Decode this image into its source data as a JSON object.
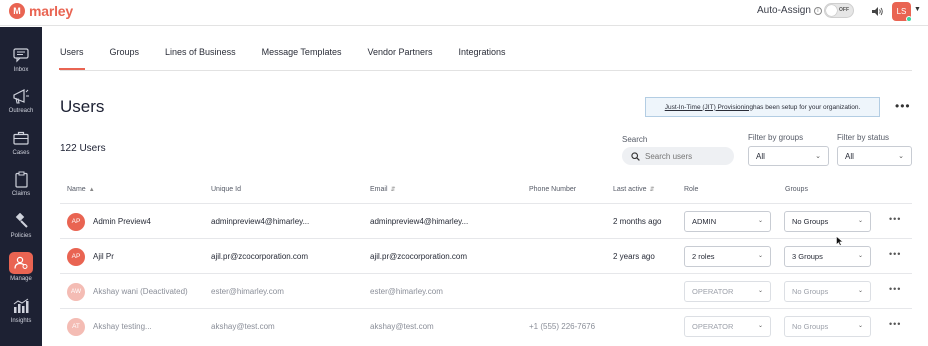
{
  "brand": {
    "name": "marley",
    "mark": "M",
    "color": "#e96452"
  },
  "topbar": {
    "auto_assign_label": "Auto-Assign",
    "info_icon": "info-icon",
    "toggle_state": "OFF",
    "speaker_icon": "speaker-icon",
    "user_initials": "LS"
  },
  "sidebar": {
    "items": [
      {
        "label": "Inbox",
        "icon": "chat-icon"
      },
      {
        "label": "Outreach",
        "icon": "megaphone-icon"
      },
      {
        "label": "Cases",
        "icon": "briefcase-icon"
      },
      {
        "label": "Claims",
        "icon": "clipboard-icon"
      },
      {
        "label": "Policies",
        "icon": "gavel-icon"
      },
      {
        "label": "Manage",
        "icon": "manage-users-icon",
        "active": true
      },
      {
        "label": "Insights",
        "icon": "bar-chart-icon"
      }
    ]
  },
  "tabs": [
    "Users",
    "Groups",
    "Lines of Business",
    "Message Templates",
    "Vendor Partners",
    "Integrations"
  ],
  "page": {
    "title": "Users",
    "banner_link": "Just-In-Time (JIT) Provisioning",
    "banner_text": " has been setup for your organization.",
    "more": "•••",
    "user_count": "122 Users"
  },
  "search": {
    "label": "Search",
    "placeholder": "Search users"
  },
  "filters": {
    "groups_label": "Filter by groups",
    "groups_value": "All",
    "status_label": "Filter by status",
    "status_value": "All"
  },
  "table": {
    "headers": {
      "name": "Name",
      "unique_id": "Unique Id",
      "email": "Email",
      "phone": "Phone Number",
      "last_active": "Last active",
      "role": "Role",
      "groups": "Groups"
    },
    "rows": [
      {
        "initials": "AP",
        "name": "Admin Preview4",
        "unique_id": "adminpreview4@himarley...",
        "email": "adminpreview4@himarley...",
        "phone": "",
        "last_active": "2 months ago",
        "role": "ADMIN",
        "groups": "No Groups",
        "more": "•••"
      },
      {
        "initials": "AP",
        "name": "Ajil Pr",
        "unique_id": "ajil.pr@zcocorporation.com",
        "email": "ajil.pr@zcocorporation.com",
        "phone": "",
        "last_active": "2 years ago",
        "role": "2 roles",
        "groups": "3 Groups",
        "more": "•••"
      },
      {
        "initials": "AW",
        "name": "Akshay wani (Deactivated)",
        "unique_id": "ester@himarley.com",
        "email": "ester@himarley.com",
        "phone": "",
        "last_active": "",
        "role": "OPERATOR",
        "groups": "No Groups",
        "more": "•••"
      },
      {
        "initials": "AT",
        "name": "Akshay testing...",
        "unique_id": "akshay@test.com",
        "email": "akshay@test.com",
        "phone": "+1 (555) 226-7676",
        "last_active": "",
        "role": "OPERATOR",
        "groups": "No Groups",
        "more": "•••"
      }
    ]
  }
}
